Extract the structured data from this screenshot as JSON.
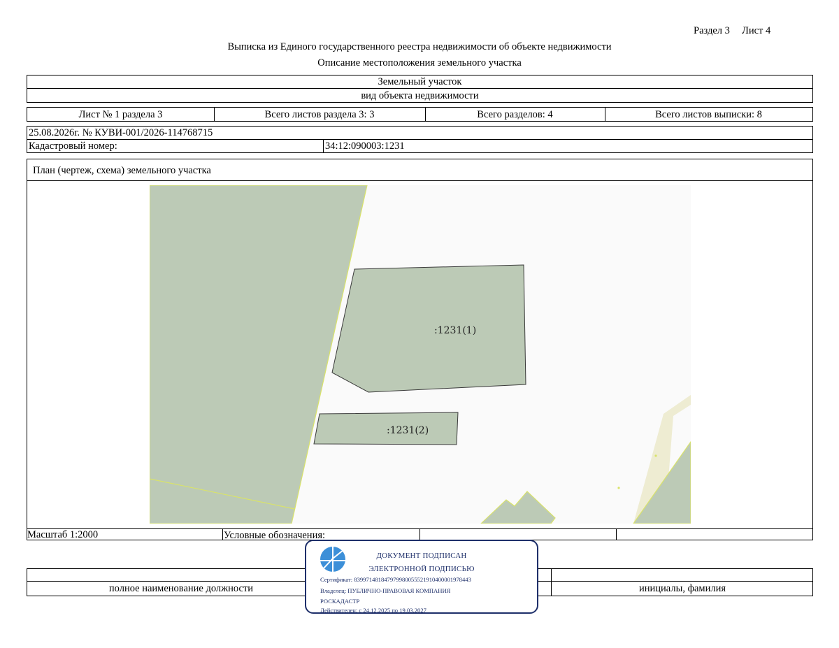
{
  "header": {
    "section_label": "Раздел 3",
    "sheet_label": "Лист 4",
    "title": "Выписка из Единого государственного реестра недвижимости об объекте недвижимости",
    "subtitle": "Описание местоположения земельного участка"
  },
  "object": {
    "name": "Земельный участок",
    "caption": "вид объекта недвижимости"
  },
  "sheets": {
    "sheet_of_section": "Лист № 1 раздела 3",
    "total_section_sheets": "Всего листов раздела 3: 3",
    "total_sections": "Всего разделов: 4",
    "total_extract_sheets": "Всего листов выписки: 8"
  },
  "record": {
    "date_number": "25.08.2026г. № КУВИ-001/2026-114768715",
    "cadastral_label": "Кадастровый номер:",
    "cadastral_value": "34:12:090003:1231"
  },
  "plan": {
    "heading": "План (чертеж, схема) земельного участка",
    "parcel_1_label": ":1231(1)",
    "parcel_2_label": ":1231(2)",
    "colors": {
      "parcel_fill": "#bccab6",
      "boundary": "#d9e36a",
      "road": "#eeecd2",
      "background": "#fafafa"
    }
  },
  "footer": {
    "scale": "Масштаб 1:2000",
    "legend_label": "Условные обозначения:",
    "position_caption": "полное наименование должности",
    "name_caption": "инициалы, фамилия"
  },
  "stamp": {
    "line1": "ДОКУМЕНТ ПОДПИСАН",
    "line2": "ЭЛЕКТРОННОЙ ПОДПИСЬЮ",
    "certificate": "Сертификат: 839971481847979980055521910400001978443",
    "owner": "Владелец: ПУБЛИЧНО-ПРАВОВАЯ КОМПАНИЯ",
    "owner_cont": "РОСКАДАСТР",
    "valid": "Действителен: с 24.12.2025 по 19.03.2027",
    "color": "#1e2f6a",
    "logo_color": "#3c8fd8"
  }
}
